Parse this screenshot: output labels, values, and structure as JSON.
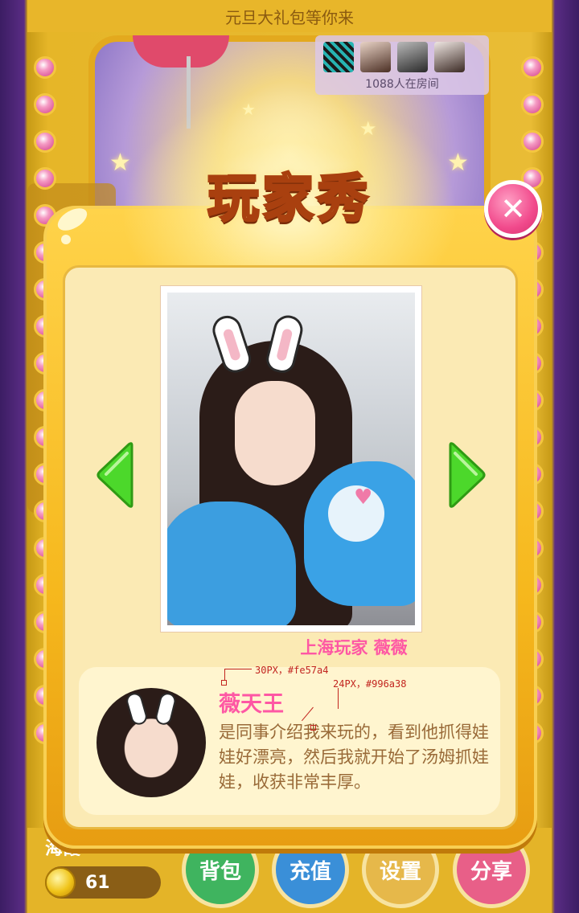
{
  "top_banner": "元旦大礼包等你来",
  "room": {
    "count_text": "1088人在房间"
  },
  "modal": {
    "title": "玩家秀",
    "close_icon": "✕",
    "photo_caption": "上海玩家 薇薇",
    "comment": {
      "name": "薇天王",
      "text": "是同事介绍我来玩的，看到他抓得娃娃好漂亮，然后我就开始了汤姆抓娃娃，收获非常丰厚。"
    }
  },
  "annotations": {
    "name_spec": "30PX，#fe57a4",
    "text_spec": "24PX，#996a38"
  },
  "bottom": {
    "player_name": "海霞",
    "coins": "61",
    "buttons": {
      "bag": "背包",
      "recharge": "充值",
      "settings": "设置",
      "share": "分享"
    }
  },
  "colors": {
    "name_pink": "#fe57a4",
    "text_brown": "#996a38",
    "arrow_green": "#4cd82b"
  }
}
